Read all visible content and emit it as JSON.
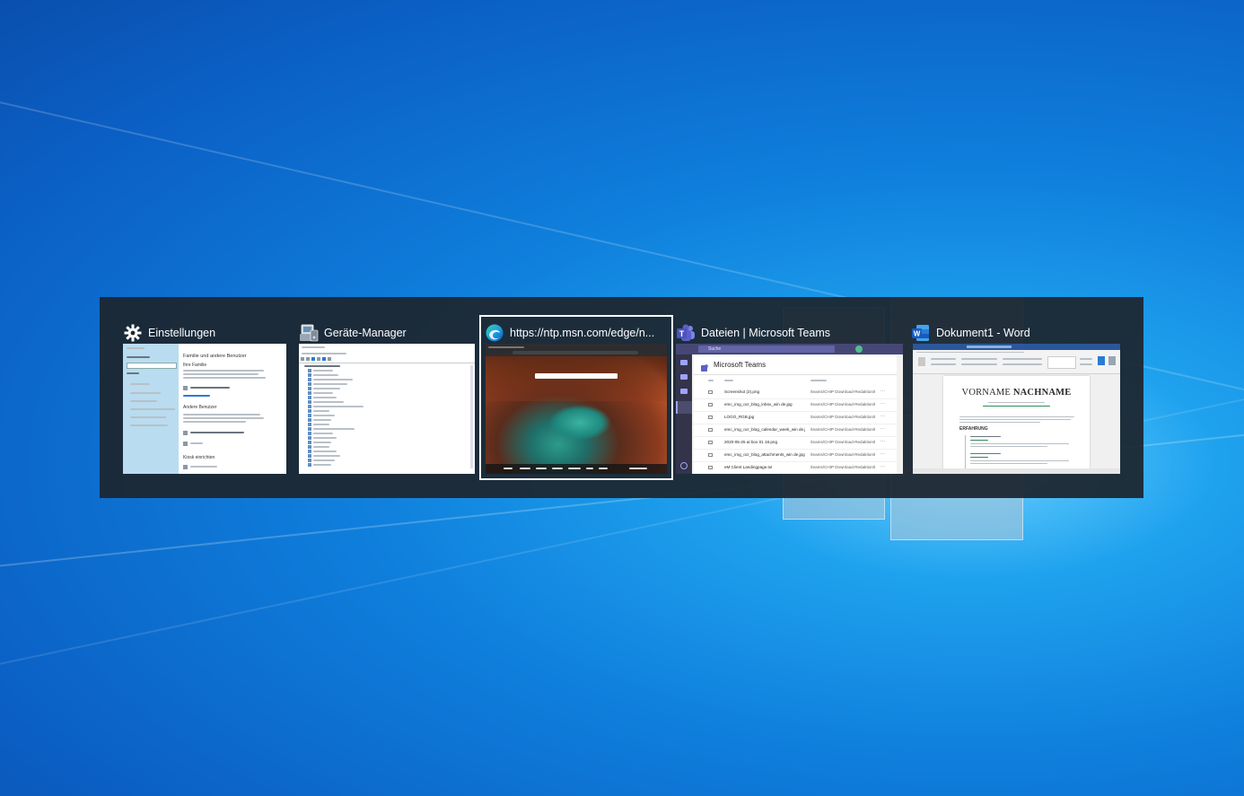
{
  "windows": [
    {
      "title": "Einstellungen",
      "icon": "gear-icon",
      "selected": false
    },
    {
      "title": "Geräte-Manager",
      "icon": "device-manager-icon",
      "selected": false
    },
    {
      "title": "https://ntp.msn.com/edge/n...",
      "icon": "edge-icon",
      "selected": true
    },
    {
      "title": "Dateien | Microsoft Teams",
      "icon": "teams-icon",
      "selected": false
    },
    {
      "title": "Dokument1 - Word",
      "icon": "word-icon",
      "selected": false
    }
  ],
  "thumbnails": {
    "settings": {
      "heading": "Familie und andere Benutzer",
      "section": "Ihre Familie",
      "section2": "Andere Benutzer",
      "section3": "Kiosk einrichten"
    },
    "teams": {
      "app_title": "Microsoft Teams",
      "search": "Suche",
      "files": [
        "Screenshot (2).png",
        "emc_img_ocr_blog_inbox_win de.jpg",
        "LOGO_RGB.jpg",
        "emc_img_ocr_blog_calendar_week_win de.jpg",
        "2020-05-25 at box 01 18.png",
        "emc_img_ocr_blog_attachments_win de.jpg",
        "eM Client Landingpage.txt"
      ],
      "path": "/teams/CHIP Download-Redaktion/Fi..."
    },
    "word": {
      "name_first": "VORNAME",
      "name_last": "NACHNAME",
      "section": "ERFAHRUNG"
    }
  },
  "colors": {
    "switcher_bg": "#1d2630",
    "selection_border": "#ffffff",
    "teams_purple": "#5b5fc7",
    "word_blue": "#2b579a",
    "edge_teal": "#0ebfb2"
  }
}
